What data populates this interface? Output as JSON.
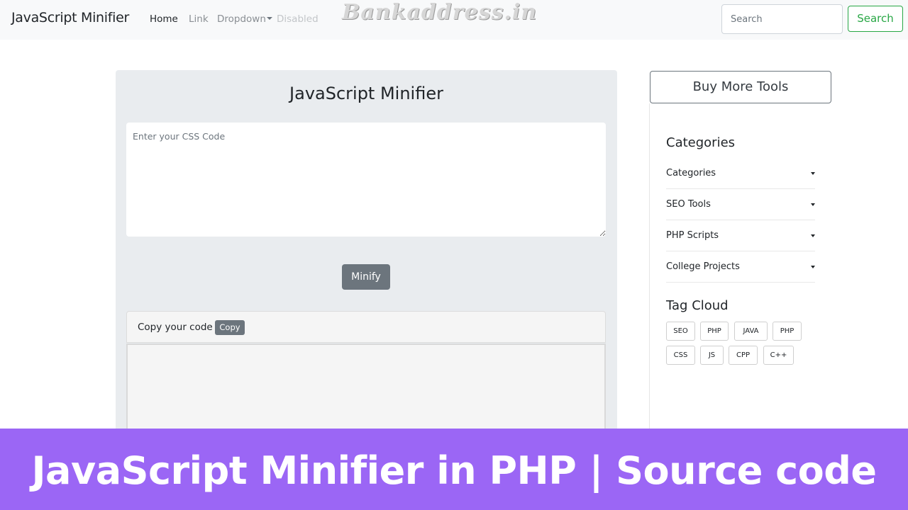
{
  "navbar": {
    "brand": "JavaScript Minifier",
    "links": {
      "home": "Home",
      "link": "Link",
      "dropdown": "Dropdown",
      "disabled": "Disabled"
    },
    "watermark": "Bankaddress.in",
    "search": {
      "placeholder": "Search",
      "button_label": "Search"
    }
  },
  "main": {
    "title": "JavaScript Minifier",
    "input_placeholder": "Enter your CSS Code",
    "minify_label": "Minify",
    "copy_label": "Copy your code",
    "copy_button": "Copy"
  },
  "sidebar": {
    "buy_button": "Buy More Tools",
    "categories_heading": "Categories",
    "categories": [
      {
        "label": "Categories"
      },
      {
        "label": "SEO Tools"
      },
      {
        "label": "PHP Scripts"
      },
      {
        "label": "College Projects"
      }
    ],
    "tag_heading": "Tag Cloud",
    "tags": [
      "SEO",
      "PHP",
      "JAVA",
      "PHP",
      "CSS",
      "JS",
      "CPP",
      "C++"
    ]
  },
  "banner": {
    "text": "JavaScript Minifier in PHP | Source code",
    "color": "#9b66f5"
  },
  "colors": {
    "success": "#28a745",
    "secondary": "#6c757d"
  }
}
